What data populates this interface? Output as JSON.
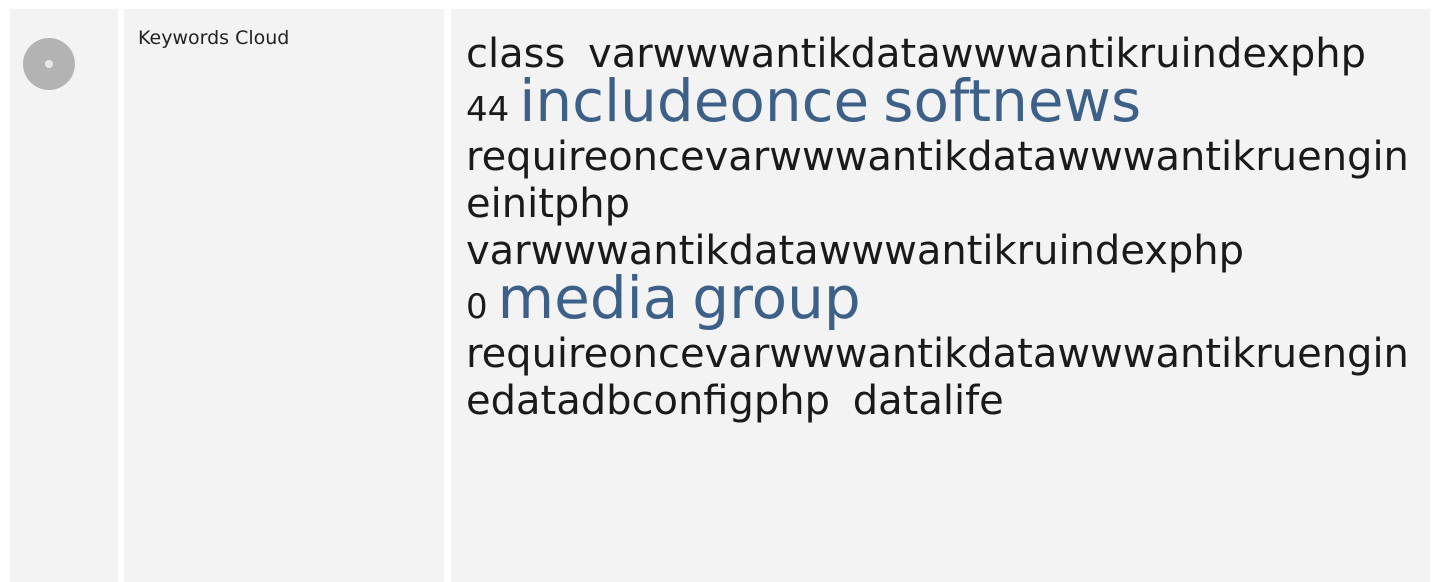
{
  "section": {
    "label": "Keywords Cloud",
    "icon": "status-circle-icon",
    "icon_color": "#b3b3b3"
  },
  "colors": {
    "panel_bg": "#f3f3f3",
    "text": "#1a1a1a",
    "highlight": "#3d6089"
  },
  "keywords": [
    {
      "text": "class",
      "size": "medium"
    },
    {
      "text": "varwwwantikdatawwwantikruindexphp",
      "size": "medium"
    },
    {
      "text": "44",
      "size": "small"
    },
    {
      "text": "includeonce",
      "size": "large"
    },
    {
      "text": "softnews",
      "size": "large"
    },
    {
      "text": "requireoncevarwwwantikdatawwwantikruengineinitphp",
      "size": "medium"
    },
    {
      "text": "varwwwantikdatawwwantikruindexphp",
      "size": "medium"
    },
    {
      "text": "0",
      "size": "small"
    },
    {
      "text": "media",
      "size": "large"
    },
    {
      "text": "group",
      "size": "large"
    },
    {
      "text": "requireoncevarwwwantikdatawwwantikruenginedatadbconfigphp",
      "size": "medium"
    },
    {
      "text": "datalife",
      "size": "medium"
    }
  ]
}
